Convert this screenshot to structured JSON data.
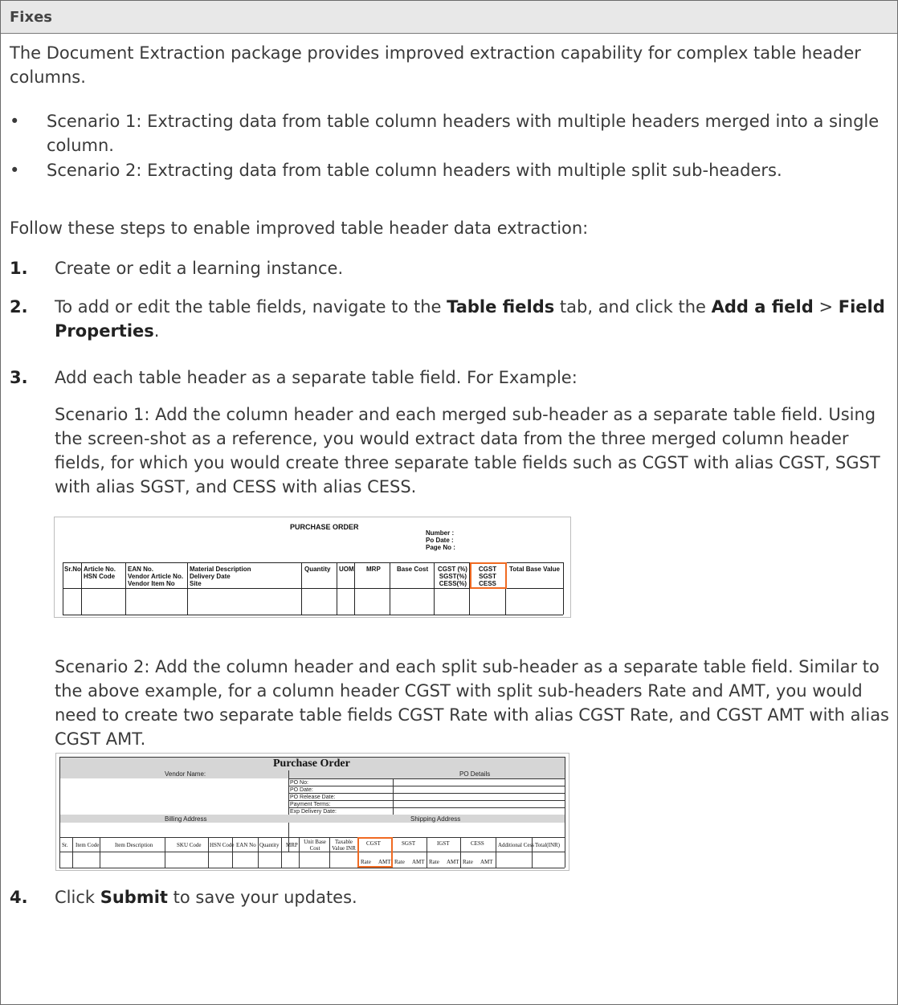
{
  "header": {
    "title": "Fixes"
  },
  "intro": "The Document Extraction package provides improved extraction capability for complex table header columns.",
  "bullets": [
    "Scenario 1: Extracting data from table column headers with multiple headers merged into a single column.",
    "Scenario 2: Extracting data from table column headers with multiple split sub-headers."
  ],
  "steps_intro": "Follow these steps to enable improved table header data extraction:",
  "steps": {
    "s1": {
      "num": "1.",
      "text": "Create or edit a learning instance."
    },
    "s2": {
      "num": "2.",
      "pre": "To add or edit the table fields, navigate to the ",
      "tab": "Table fields",
      "mid": " tab, and click the ",
      "add": "Add a field",
      "sep": " > ",
      "props": "Field Properties",
      "end": "."
    },
    "s3": {
      "num": "3.",
      "text": "Add each table header as a separate table field. For Example:"
    },
    "s4": {
      "num": "4.",
      "pre": "Click ",
      "submit": "Submit",
      "end": "  to save your updates."
    }
  },
  "scenario1_text": "Scenario 1: Add the column header and each merged sub-header as a separate table field. Using the screen-shot as a reference, you would extract data from the three merged column header fields, for which you would create three separate table fields such as CGST with alias CGST, SGST with alias SGST, and CESS with alias CESS.",
  "scenario2_text": "Scenario 2: Add the column header and each split sub-header as a separate table field. Similar to the above example, for a column header CGST with split sub-headers Rate and AMT, you would need to create two separate table fields CGST Rate with alias CGST Rate, and CGST AMT with alias CGST AMT.",
  "figure1": {
    "title": "PURCHASE ORDER",
    "meta": [
      "Number  :",
      "Po Date   :",
      "Page No  :"
    ],
    "columns": {
      "sr": "Sr.No",
      "article": "Article No.\nHSN Code",
      "ean": "EAN No.\nVendor Article No.\nVendor Item No",
      "material": "Material Description\nDelivery Date\nSite",
      "qty": "Quantity",
      "uom": "UOM",
      "mrp": "MRP",
      "base": "Base Cost",
      "gst": "CGST (%)\nSGST(%)\nCESS(%)",
      "tax": "CGST\nSGST\nCESS",
      "total": "Total Base Value"
    },
    "highlight_color": "#f06a22"
  },
  "figure2": {
    "title": "Purchase Order",
    "vendor": "Vendor Name:",
    "po_details": "PO Details",
    "po_rows": [
      "PO No:",
      "PO Date:",
      "PO Release Date:",
      "Payment Terms:",
      "Exp Delivery Date:"
    ],
    "billing": "Billing Address",
    "shipping": "Shipping Address",
    "columns": [
      "Sr.",
      "Item Code",
      "Item Description",
      "SKU Code",
      "HSN Code",
      "EAN No",
      "Quantity",
      "MRP",
      "Unit Base Cost",
      "Taxable Value INR",
      "CGST",
      "SGST",
      "IGST",
      "CESS",
      "Additional Cess",
      "Total(INR)"
    ],
    "sub": {
      "rate": "Rate",
      "amt": "AMT"
    }
  }
}
